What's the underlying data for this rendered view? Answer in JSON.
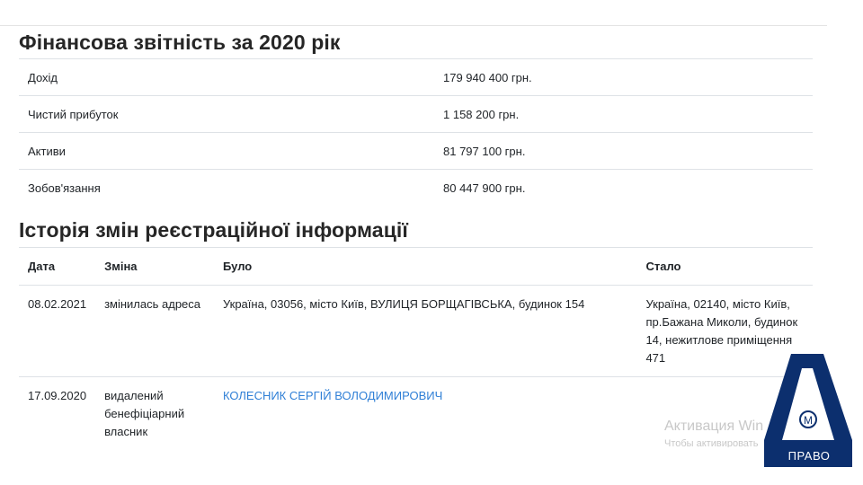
{
  "financial": {
    "title": "Фінансова звітність за 2020 рік",
    "rows": [
      {
        "label": "Дохід",
        "value": "179 940 400 грн."
      },
      {
        "label": "Чистий прибуток",
        "value": "1 158 200 грн."
      },
      {
        "label": "Активи",
        "value": "81 797 100 грн."
      },
      {
        "label": "Зобов'язання",
        "value": "80 447 900 грн."
      }
    ]
  },
  "history": {
    "title": "Історія змін реєстраційної інформації",
    "headers": {
      "date": "Дата",
      "change": "Зміна",
      "was": "Було",
      "became": "Стало"
    },
    "rows": [
      {
        "date": "08.02.2021",
        "change": "змінилась адреса",
        "was": "Україна, 03056, місто Київ, ВУЛИЦЯ БОРЩАГІВСЬКА, будинок 154",
        "became": "Україна, 02140, місто Київ, пр.Бажана Миколи, будинок 14, нежитлове приміщення 471"
      },
      {
        "date": "17.09.2020",
        "change": "видалений бенефіціарний власник",
        "was": "КОЛЕСНИК СЕРГІЙ ВОЛОДИМИРОВИЧ",
        "became": ""
      }
    ]
  },
  "watermark": {
    "line1": "Активация Win",
    "line2": "Чтобы активировать"
  },
  "logo": {
    "text": "ПРАВО",
    "color": "#0c2f6e"
  },
  "colors": {
    "link": "#2f7fd6"
  }
}
